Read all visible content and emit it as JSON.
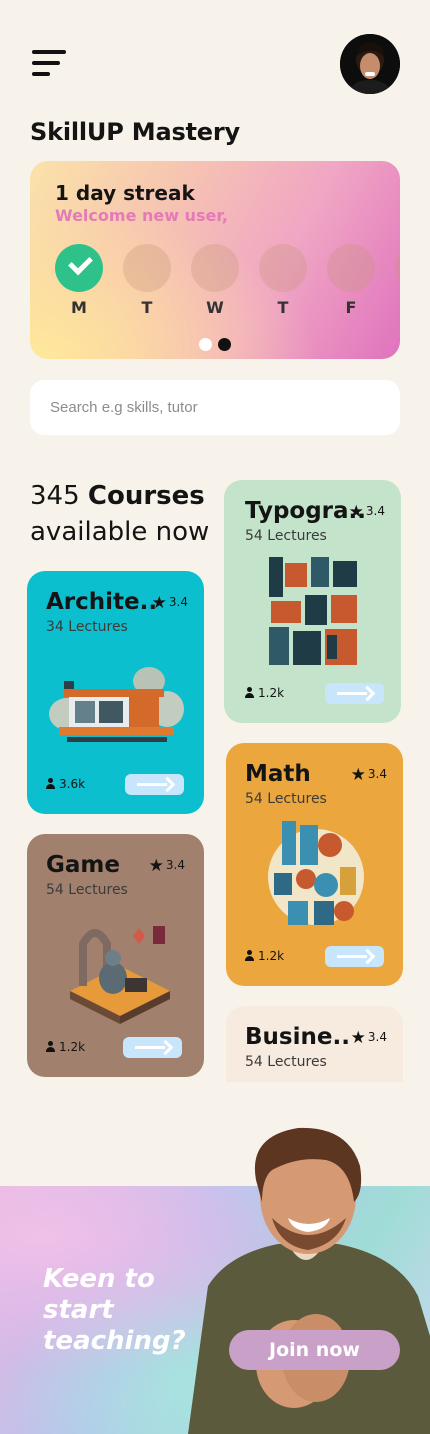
{
  "header": {
    "menu_icon": "hamburger-menu-icon",
    "avatar_alt": "user avatar"
  },
  "app": {
    "title": "SkillUP Mastery"
  },
  "streak": {
    "title": "1 day streak",
    "subtitle": "Welcome new user,",
    "days": [
      {
        "label": "M",
        "done": true
      },
      {
        "label": "T",
        "done": false
      },
      {
        "label": "W",
        "done": false
      },
      {
        "label": "T",
        "done": false
      },
      {
        "label": "F",
        "done": false
      }
    ],
    "page_count": 2,
    "active_page": 2
  },
  "search": {
    "placeholder": "Search e.g skills, tutor",
    "value": ""
  },
  "courses_heading": {
    "count": "345",
    "word": "Courses",
    "line2": "available now"
  },
  "courses": [
    {
      "name": "Archite..",
      "rating": "3.4",
      "lectures": "34 Lectures",
      "learners": "3.6k",
      "color": "#0bbfcf"
    },
    {
      "name": "Typogra..",
      "rating": "3.4",
      "lectures": "54 Lectures",
      "learners": "1.2k",
      "color": "#c4e3cb"
    },
    {
      "name": "Game",
      "rating": "3.4",
      "lectures": "54 Lectures",
      "learners": "1.2k",
      "color": "#a1806e"
    },
    {
      "name": "Math",
      "rating": "3.4",
      "lectures": "54 Lectures",
      "learners": "1.2k",
      "color": "#eba73d"
    },
    {
      "name": "Busine..",
      "rating": "3.4",
      "lectures": "54 Lectures",
      "learners": "",
      "color": "#f7ebdf"
    }
  ],
  "banner": {
    "text": "Keen to start teaching?",
    "button_label": "Join now"
  }
}
